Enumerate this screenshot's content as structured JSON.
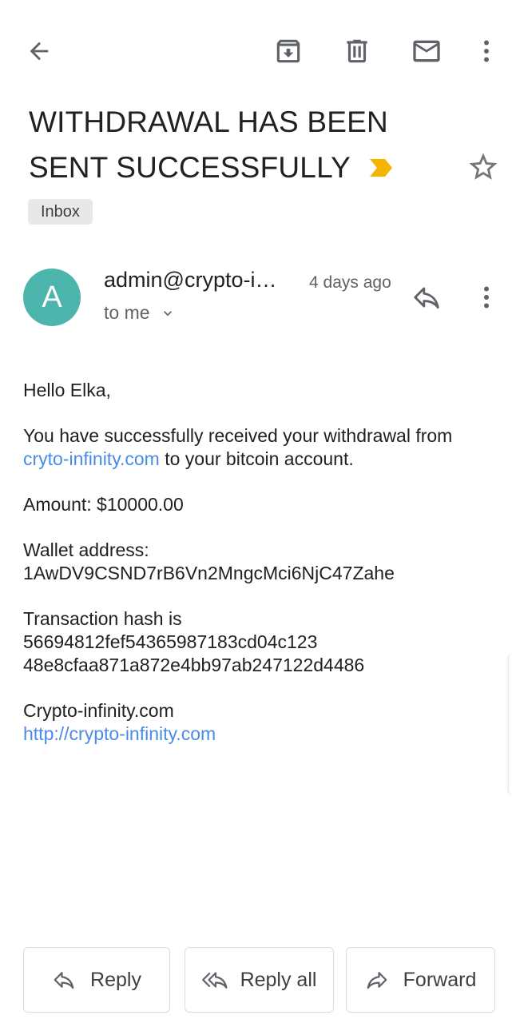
{
  "toolbar": {
    "back": "arrow-back-icon",
    "archive": "archive-icon",
    "delete": "trash-icon",
    "mark_unread": "mail-icon",
    "more": "more-vertical-icon"
  },
  "subject": {
    "line1": "WITHDRAWAL HAS BEEN",
    "line2": "SENT SUCCESSFULLY",
    "importance_color": "#f4b400"
  },
  "label": "Inbox",
  "sender": {
    "avatar_letter": "A",
    "avatar_color": "#4db6ac",
    "name": "admin@crypto-i…",
    "time": "4 days ago",
    "recipient": "to me"
  },
  "body": {
    "greeting": "Hello Elka,",
    "line1_pre": "You have successfully received your withdrawal from",
    "line1_link": "cryto-infinity.com",
    "line1_post": "to your bitcoin account.",
    "amount": "Amount: $10000.00",
    "wallet_label": "Wallet address:",
    "wallet_value": "1AwDV9CSND7rB6Vn2MngcMci6NjC47Zahe",
    "hash_label": "Transaction hash is",
    "hash_line1": "56694812fef54365987183cd04c123",
    "hash_line2": "48e8cfaa871a872e4bb97ab247122d4486",
    "signature": "Crypto-infinity.com",
    "signature_link": "http://crypto-infinity.com",
    "link_color": "#4a8be8"
  },
  "actions": {
    "reply": "Reply",
    "reply_all": "Reply all",
    "forward": "Forward"
  }
}
